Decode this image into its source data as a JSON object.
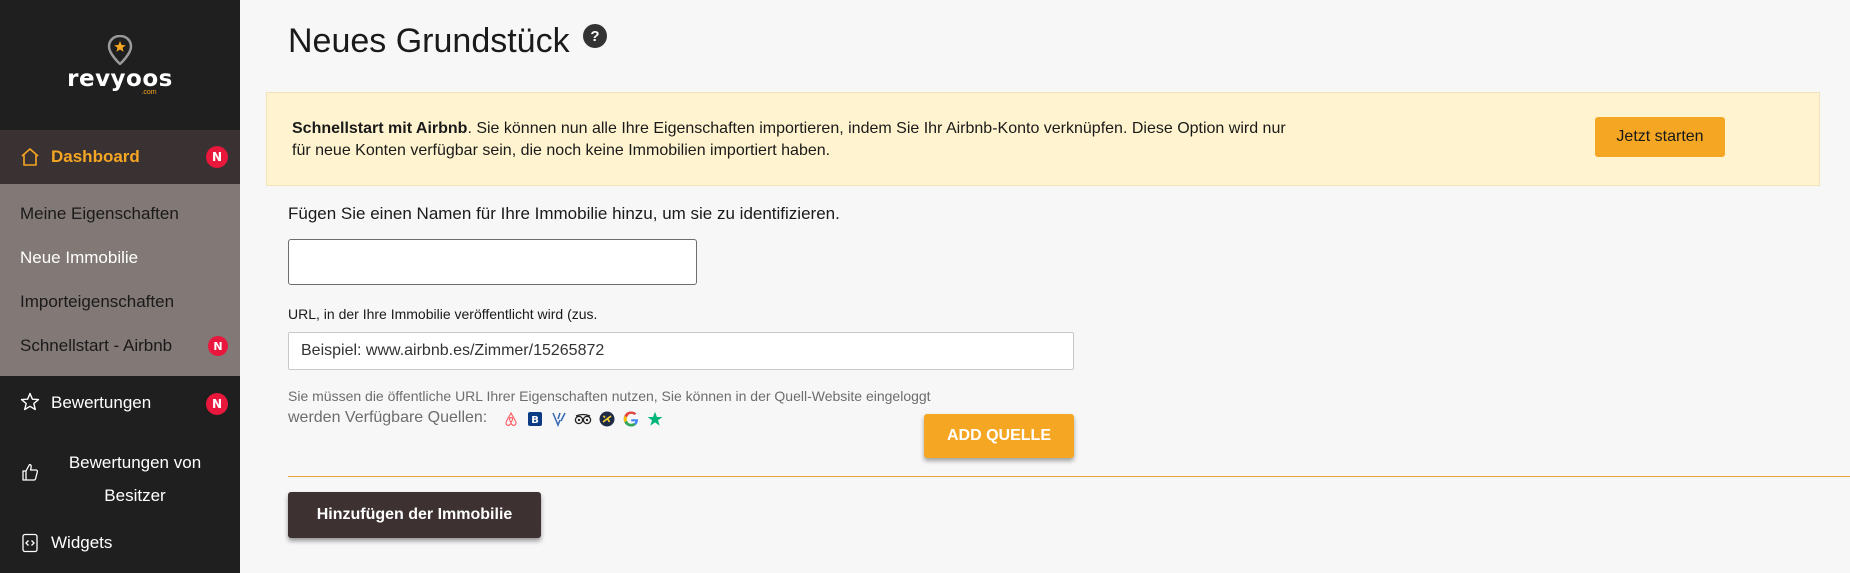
{
  "brand": {
    "name": "revyoos",
    "sub": ".com"
  },
  "sidebar": {
    "dashboard": {
      "label": "Dashboard",
      "badge": "N"
    },
    "submenu": [
      {
        "label": "Meine Eigenschaften"
      },
      {
        "label": "Neue Immobilie",
        "active": true
      },
      {
        "label": "Importeigenschaften"
      },
      {
        "label": "Schnellstart - Airbnb",
        "badge": "N"
      }
    ],
    "items": [
      {
        "label": "Bewertungen",
        "badge": "N",
        "icon": "star-icon"
      },
      {
        "label": "Bewertungen von Besitzer",
        "icon": "thumbs-up-icon"
      },
      {
        "label": "Widgets",
        "icon": "code-file-icon"
      }
    ]
  },
  "page": {
    "title": "Neues Grundstück",
    "help": "?"
  },
  "banner": {
    "bold": "Schnellstart mit Airbnb",
    "text": ". Sie können nun alle Ihre Eigenschaften importieren, indem Sie Ihr Airbnb-Konto verknüpfen. Diese Option wird nur für neue Konten verfügbar sein, die noch keine Immobilien importiert haben.",
    "button": "Jetzt starten"
  },
  "form": {
    "name_label": "Fügen Sie einen Namen für Ihre Immobilie hinzu, um sie zu identifizieren.",
    "name_value": "",
    "url_label": "URL, in der Ihre Immobilie veröffentlicht wird (zus.",
    "url_placeholder": "Beispiel: www.airbnb.es/Zimmer/15265872",
    "hint_line1": "Sie müssen die öffentliche URL Ihrer Eigenschaften nutzen, Sie können in der Quell-Website eingeloggt",
    "hint_line2": "werden Verfügbare Quellen:",
    "sources": [
      "airbnb-icon",
      "booking-icon",
      "vrbo-icon",
      "tripadvisor-icon",
      "expedia-icon",
      "google-icon",
      "trustpilot-icon"
    ],
    "add_source": "ADD QUELLE",
    "submit": "Hinzufügen der Immobilie"
  },
  "colors": {
    "accent": "#f5a623",
    "sidebar": "#1f1f1f",
    "badge": "#e8173b",
    "submit": "#3d3132"
  }
}
